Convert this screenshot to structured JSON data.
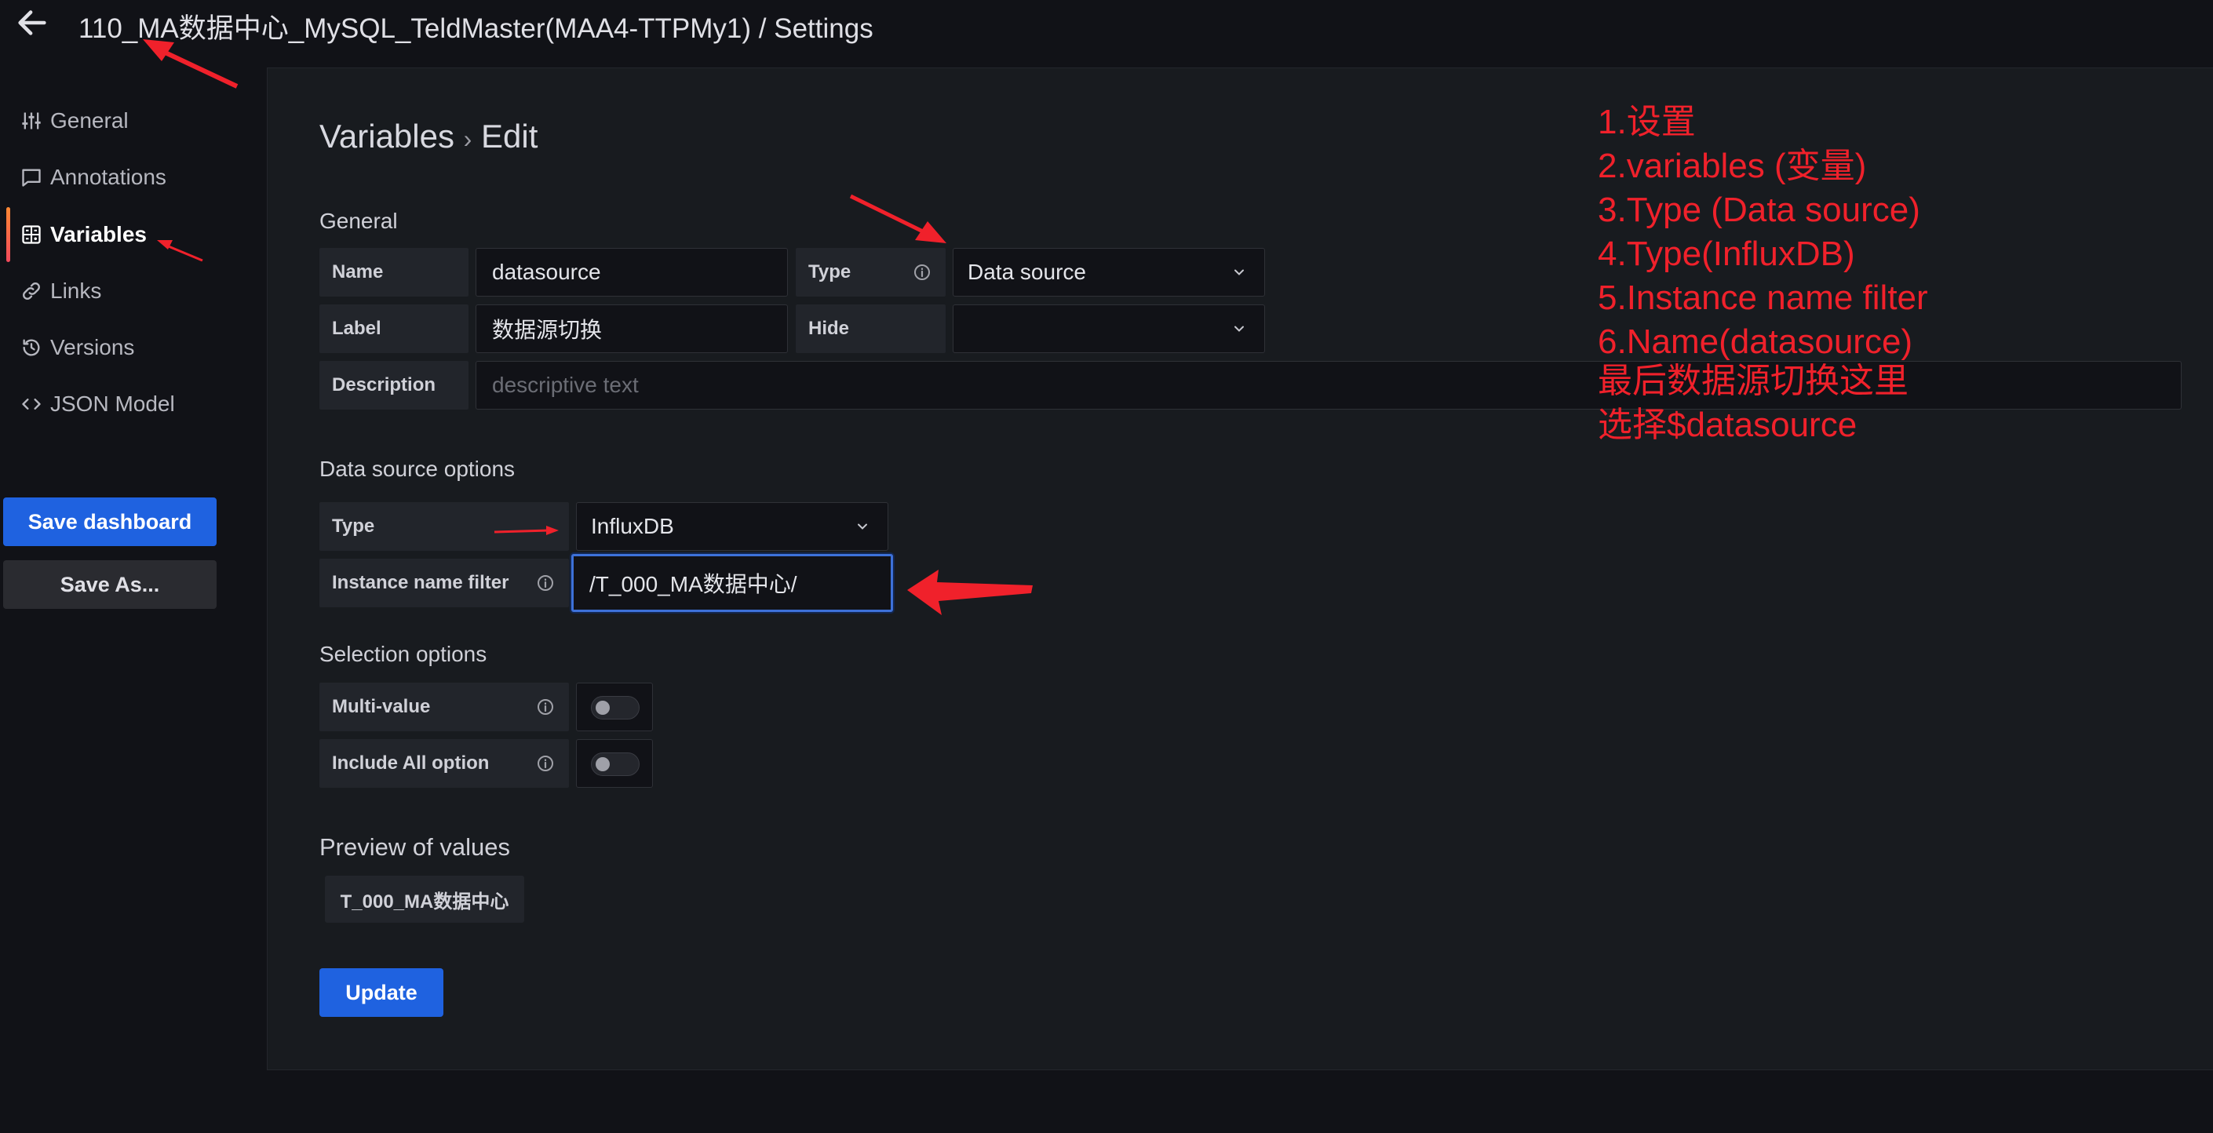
{
  "header": {
    "title": "110_MA数据中心_MySQL_TeldMaster(MAA4-TTPMy1) / Settings",
    "back_icon": "arrow-left-icon"
  },
  "sidebar": {
    "items": [
      {
        "label": "General",
        "icon": "sliders-icon"
      },
      {
        "label": "Annotations",
        "icon": "comment-icon"
      },
      {
        "label": "Variables",
        "icon": "calculator-icon",
        "active": true
      },
      {
        "label": "Links",
        "icon": "link-icon"
      },
      {
        "label": "Versions",
        "icon": "history-icon"
      },
      {
        "label": "JSON Model",
        "icon": "code-icon"
      }
    ],
    "save_dashboard": "Save dashboard",
    "save_as": "Save As..."
  },
  "main": {
    "heading": "Variables",
    "heading_sep": "›",
    "heading_sub": "Edit",
    "general": {
      "title": "General",
      "name_label": "Name",
      "name_value": "datasource",
      "type_label": "Type",
      "type_value": "Data source",
      "label_label": "Label",
      "label_value": "数据源切换",
      "hide_label": "Hide",
      "hide_value": "",
      "description_label": "Description",
      "description_placeholder": "descriptive text"
    },
    "ds_options": {
      "title": "Data source options",
      "type_label": "Type",
      "type_value": "InfluxDB",
      "filter_label": "Instance name filter",
      "filter_value": "/T_000_MA数据中心/"
    },
    "selection": {
      "title": "Selection options",
      "multi_label": "Multi-value",
      "multi_on": false,
      "include_all_label": "Include All option",
      "include_all_on": false
    },
    "preview": {
      "title": "Preview of values",
      "values": [
        "T_000_MA数据中心"
      ]
    },
    "update_button": "Update"
  },
  "annotation_notes": [
    "1.设置",
    "2.variables (变量)",
    "3.Type (Data source)",
    "4.Type(InfluxDB)",
    "5.Instance name filter",
    "6.Name(datasource)",
    "最后数据源切换这里",
    "选择$datasource"
  ],
  "colors": {
    "background": "#111217",
    "panel": "#181b1f",
    "primary": "#1f62e0",
    "annotation": "#f0212b"
  }
}
